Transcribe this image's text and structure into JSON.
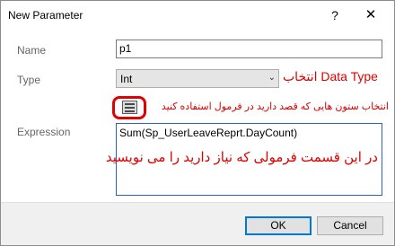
{
  "window": {
    "title": "New Parameter",
    "help_glyph": "?",
    "close_glyph": "✕"
  },
  "form": {
    "name_label": "Name",
    "name_value": "p1",
    "type_label": "Type",
    "type_value": "Int",
    "expression_label": "Expression",
    "expression_value": "Sum(Sp_UserLeaveReprt.DayCount)"
  },
  "annotations": {
    "data_type": "انتخاب Data Type",
    "columns_hint": "انتخاب ستون هایی که قصد دارید در فرمول استفاده کنید",
    "formula_hint": "در این قسمت فرمولی که نیاز دارید را می نویسید",
    "color": "#e00000"
  },
  "buttons": {
    "ok": "OK",
    "cancel": "Cancel"
  },
  "icons": {
    "help": "help-icon",
    "close": "close-icon",
    "dropdown": "chevron-down-icon",
    "expression_builder": "calculator-icon"
  },
  "colors": {
    "accent_focus": "#0078d7",
    "annotation": "#e00000"
  }
}
